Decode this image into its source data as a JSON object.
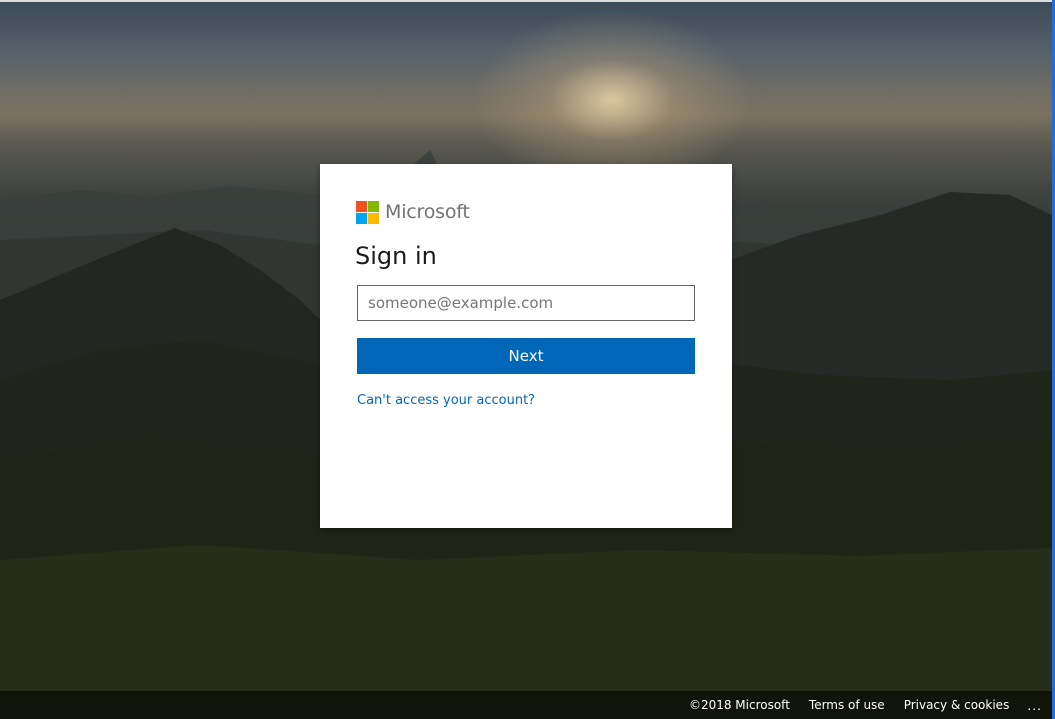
{
  "brand": {
    "name": "Microsoft",
    "logo_colors": [
      "#f25022",
      "#7fba00",
      "#00a4ef",
      "#ffb900"
    ]
  },
  "signin": {
    "title": "Sign in",
    "email_value": "",
    "email_placeholder": "someone@example.com",
    "next_label": "Next",
    "help_link": "Can't access your account?"
  },
  "footer": {
    "copyright": "©2018 Microsoft",
    "terms": "Terms of use",
    "privacy": "Privacy & cookies",
    "more": "..."
  },
  "colors": {
    "accent": "#0067b8",
    "background": "#1d1f1a"
  }
}
